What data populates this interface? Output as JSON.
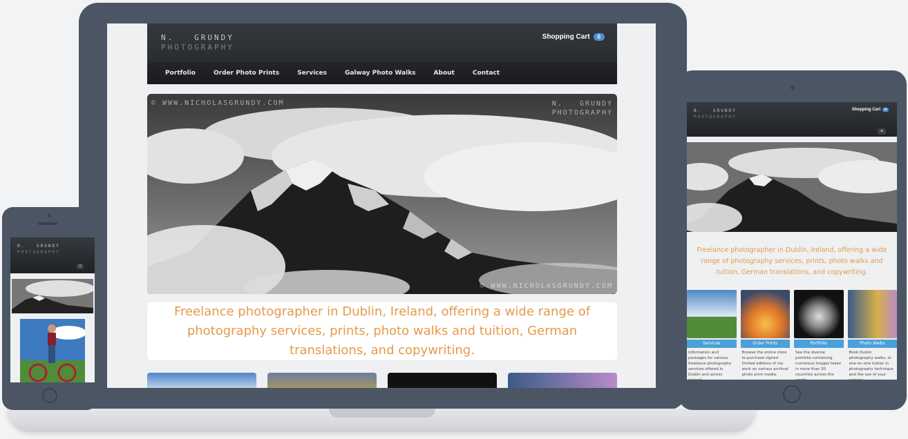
{
  "site": {
    "logo_line1": "N.   GRUNDY",
    "logo_line2": "PHOTOGRAPHY",
    "cart_label": "Shopping Cart",
    "cart_count": "0",
    "nav": [
      "Portfolio",
      "Order Photo Prints",
      "Services",
      "Galway Photo Walks",
      "About",
      "Contact"
    ],
    "hero_watermark_left": "© WWW.NICHOLASGRUNDY.COM",
    "hero_watermark_right_1": "N.   GRUNDY",
    "hero_watermark_right_2": "PHOTOGRAPHY",
    "hero_watermark_bottom": "© WWW.NICHOLASGRUNDY.COM",
    "tagline": "Freelance photographer in Dublin, Ireland, offering a wide range of photography services, prints, photo walks and tuition, German translations, and copywriting."
  },
  "tablet": {
    "tagline": "Freelance photographer in Dublin, Ireland, offering a wide range of photography services, prints, photo walks and tuition, German translations, and copywriting.",
    "menu_icon": "≡",
    "tiles": [
      {
        "label": "Services",
        "text": "Information and packages for various freelance photography services offered in Dublin and across Ireland."
      },
      {
        "label": "Order Prints",
        "text": "Browse the online store to purchase signed limited editions of my work on various archival photo print media."
      },
      {
        "label": "Portfolio",
        "text": "See the diverse portfolio containing numerous images taken in more than 30 countries across the world."
      },
      {
        "label": "Photo Walks",
        "text": "Book Dublin photography walks, or one-on-one tuition in photography technique and the use of your camera."
      }
    ]
  },
  "colors": {
    "device_frame": "#4c5563",
    "accent_orange": "#e59a4a",
    "accent_blue": "#4aa0d8",
    "header_dark": "#232528"
  }
}
